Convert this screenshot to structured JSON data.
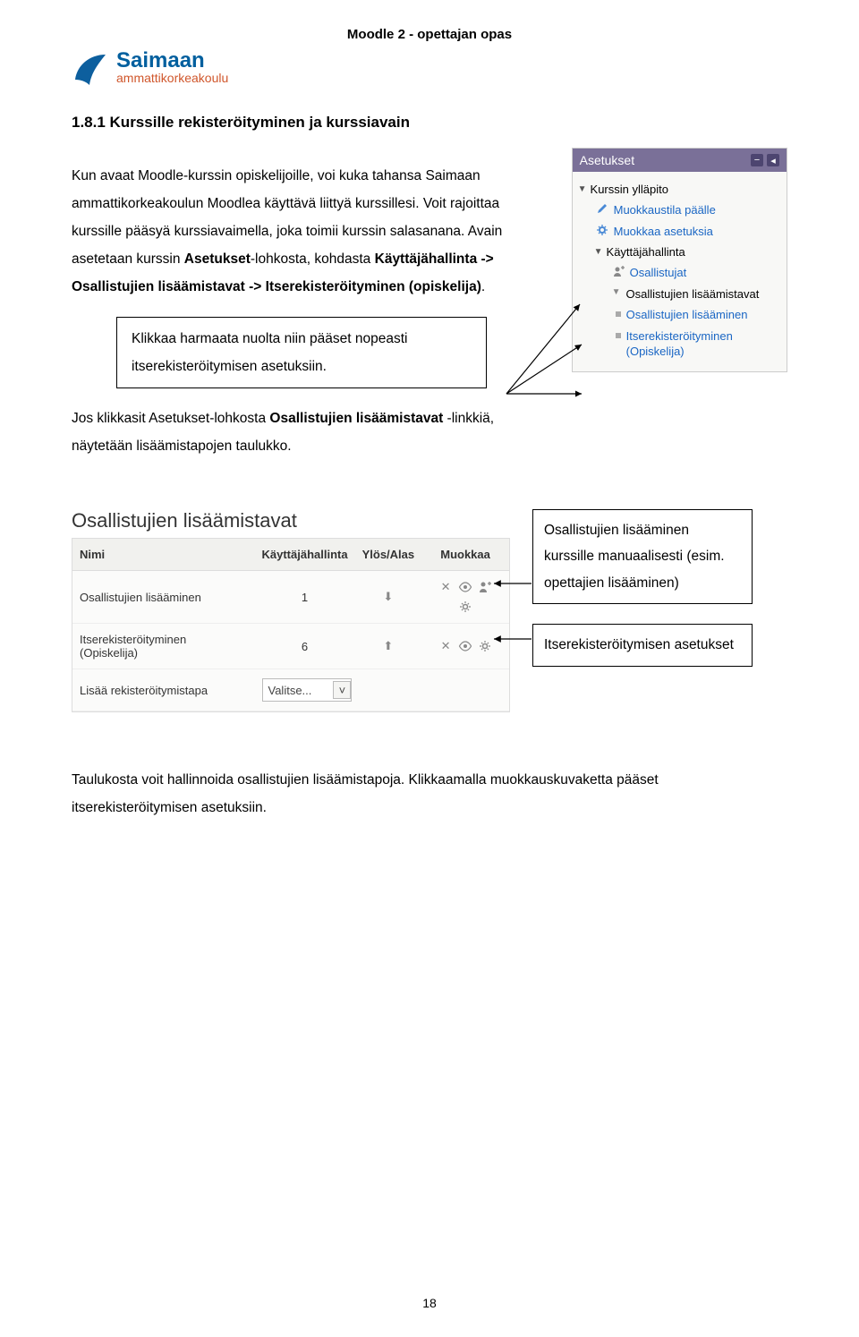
{
  "header": "Moodle 2 - opettajan opas",
  "logo": {
    "top": "Saimaan",
    "bottom": "ammattikorkeakoulu"
  },
  "section_title": "1.8.1 Kurssille rekisteröityminen ja kurssiavain",
  "para1_a": "Kun avaat Moodle-kurssin opiskelijoille, voi kuka tahansa Saimaan ammattikorkeakoulun Moodlea käyttävä liittyä kurssillesi. Voit rajoittaa kurssille pääsyä kurssiavaimella, joka toimii kurssin salasanana. Avain asetetaan kurssin ",
  "para1_bold1": "Asetukset",
  "para1_b": "-lohkosta, kohdasta ",
  "para1_bold2": "Käyttäjähallinta -> Osallistujien lisäämistavat -> Itserekisteröityminen (opiskelija)",
  "para1_c": ".",
  "callout": "Klikkaa harmaata nuolta niin pääset nopeasti itserekisteröitymisen asetuksiin.",
  "para2_a": "Jos klikkasit Asetukset-lohkosta ",
  "para2_bold": "Osallistujien lisäämistavat",
  "para2_b": " -linkkiä, näytetään lisäämistapojen taulukko.",
  "settings": {
    "title": "Asetukset",
    "group1": "Kurssin ylläpito",
    "item_edit": "Muokkaustila päälle",
    "item_settings": "Muokkaa asetuksia",
    "group2": "Käyttäjähallinta",
    "item_users": "Osallistujat",
    "item_methods": "Osallistujien lisäämistavat",
    "sub_add": "Osallistujien lisääminen",
    "sub_self": "Itserekisteröityminen (Opiskelija)"
  },
  "table": {
    "title": "Osallistujien lisäämistavat",
    "cols": {
      "name": "Nimi",
      "kh": "Käyttäjähallinta",
      "ud": "Ylös/Alas",
      "edit": "Muokkaa"
    },
    "row1": {
      "name": "Osallistujien lisääminen",
      "kh": "1"
    },
    "row2": {
      "name": "Itserekisteröityminen (Opiskelija)",
      "kh": "6"
    },
    "add_label": "Lisää rekisteröitymistapa",
    "select": "Valitse..."
  },
  "note1": "Osallistujien lisääminen kurssille manuaalisesti (esim. opettajien lisääminen)",
  "note2": "Itserekisteröitymisen asetukset",
  "para3": "Taulukosta voit hallinnoida osallistujien lisäämistapoja. Klikkaamalla muokkauskuvaketta pääset itserekisteröitymisen asetuksiin.",
  "page_num": "18"
}
